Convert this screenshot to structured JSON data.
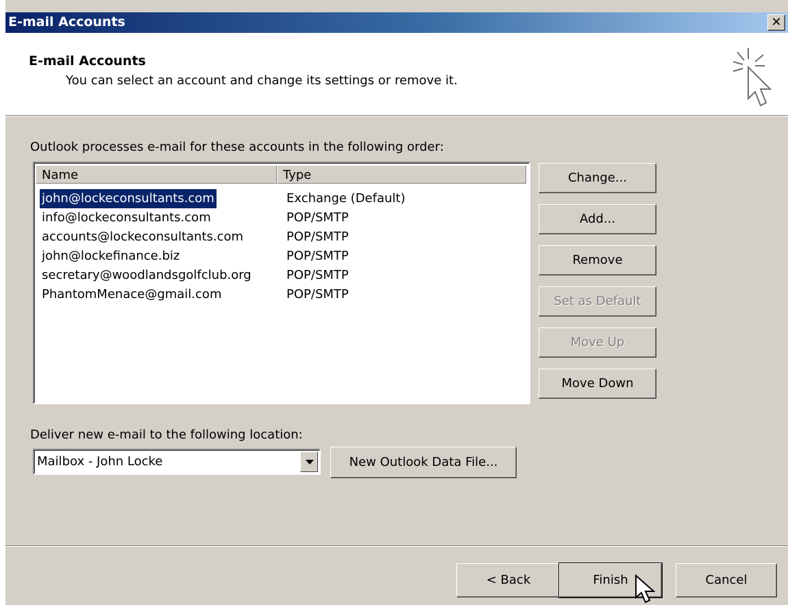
{
  "window": {
    "title": "E-mail Accounts",
    "close_label": "✕"
  },
  "header": {
    "title": "E-mail Accounts",
    "subtitle": "You can select an account and change its settings or remove it."
  },
  "accounts_list": {
    "label": "Outlook processes e-mail for these accounts in the following order:",
    "columns": {
      "name": "Name",
      "type": "Type"
    },
    "rows": [
      {
        "name": "john@lockeconsultants.com",
        "type": "Exchange (Default)",
        "selected": true
      },
      {
        "name": "info@lockeconsultants.com",
        "type": "POP/SMTP"
      },
      {
        "name": "accounts@lockeconsultants.com",
        "type": "POP/SMTP"
      },
      {
        "name": "john@lockefinance.biz",
        "type": "POP/SMTP"
      },
      {
        "name": "secretary@woodlandsgolfclub.org",
        "type": "POP/SMTP"
      },
      {
        "name": "PhantomMenace@gmail.com",
        "type": "POP/SMTP"
      }
    ]
  },
  "side_buttons": {
    "change": "Change...",
    "add": "Add...",
    "remove": "Remove",
    "set_default": "Set as Default",
    "move_up": "Move Up",
    "move_down": "Move Down"
  },
  "delivery": {
    "label": "Deliver new e-mail to the following location:",
    "selected_value": "Mailbox - John Locke",
    "new_data_file": "New Outlook Data File..."
  },
  "footer": {
    "back": "< Back",
    "finish": "Finish",
    "cancel": "Cancel"
  },
  "icons": {
    "wizard": "wizard-cursor-sparkle-icon",
    "dropdown": "chevron-down-icon",
    "cursor": "mouse-pointer-icon",
    "close": "close-icon"
  },
  "colors": {
    "title_bar": "#0a246a",
    "face": "#d4d0c8",
    "selection": "#0a246a"
  }
}
